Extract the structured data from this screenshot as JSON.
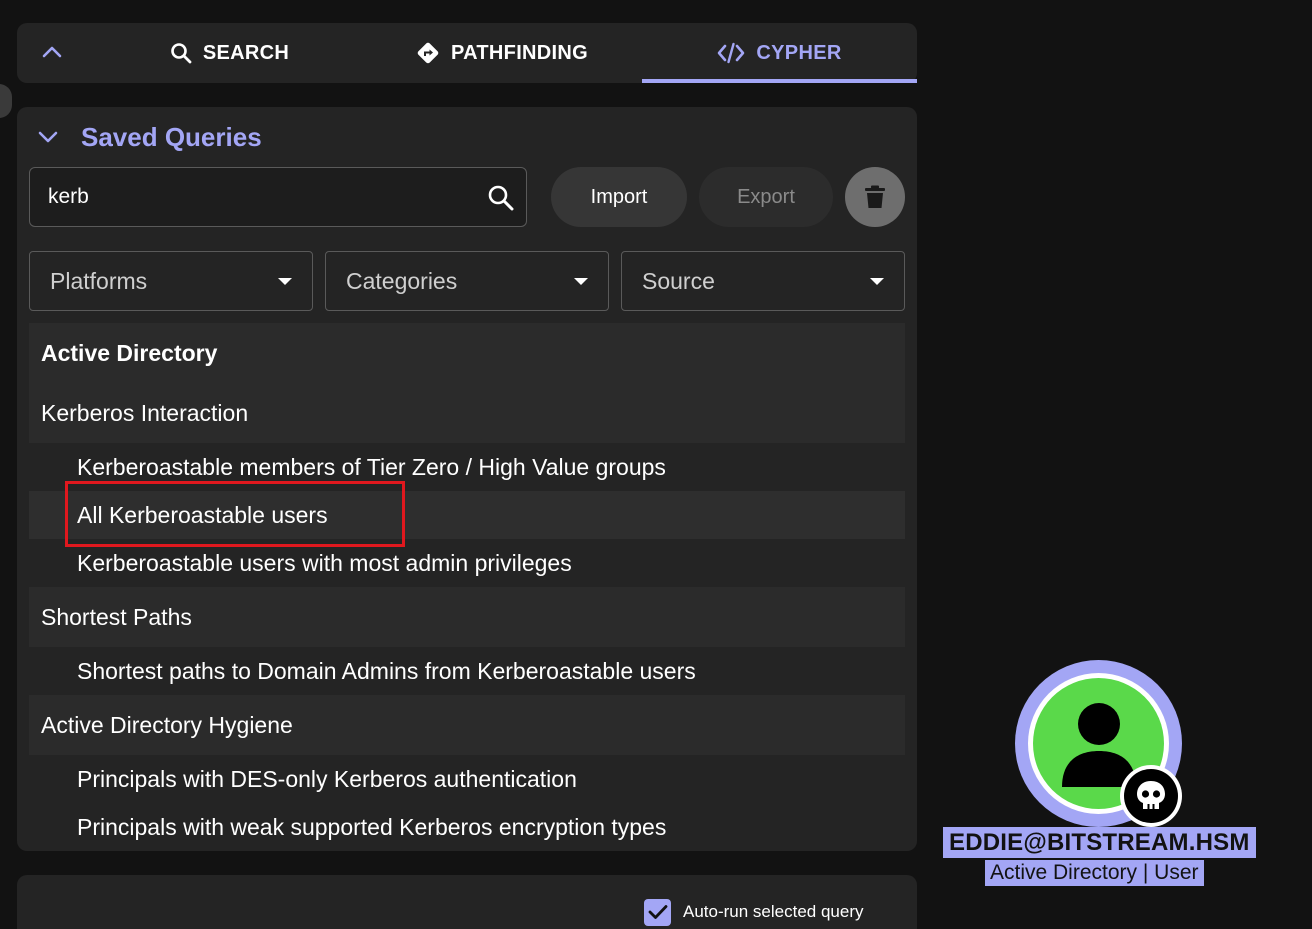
{
  "tabs": [
    {
      "label": "SEARCH",
      "icon": "search-icon"
    },
    {
      "label": "PATHFINDING",
      "icon": "route-diamond-icon"
    },
    {
      "label": "CYPHER",
      "icon": "code-icon",
      "active": true
    }
  ],
  "saved_queries": {
    "title": "Saved Queries",
    "search_value": "kerb",
    "search_placeholder": "",
    "import_label": "Import",
    "export_label": "Export",
    "filters": {
      "platforms": "Platforms",
      "categories": "Categories",
      "source": "Source"
    },
    "platform": "Active Directory",
    "groups": [
      {
        "name": "Kerberos Interaction",
        "items": [
          "Kerberoastable members of Tier Zero / High Value groups",
          "All Kerberoastable users",
          "Kerberoastable users with most admin privileges"
        ]
      },
      {
        "name": "Shortest Paths",
        "items": [
          "Shortest paths to Domain Admins from Kerberoastable users"
        ]
      },
      {
        "name": "Active Directory Hygiene",
        "items": [
          "Principals with DES-only Kerberos authentication",
          "Principals with weak supported Kerberos encryption types"
        ]
      }
    ],
    "selected_item": "All Kerberoastable users"
  },
  "options": {
    "autorun_label": "Auto-run selected query",
    "autorun_checked": true
  },
  "graph_node": {
    "name": "EDDIE@BITSTREAM.HSM",
    "subtitle": "Active Directory | User",
    "icon": "user-icon",
    "badge_icon": "skull-icon",
    "colors": {
      "ring": "#a3a6f5",
      "fill": "#5ad94a"
    }
  },
  "colors": {
    "accent": "#a3a6f5",
    "background": "#121212",
    "panel": "#242424",
    "highlight": "#e0181e"
  }
}
